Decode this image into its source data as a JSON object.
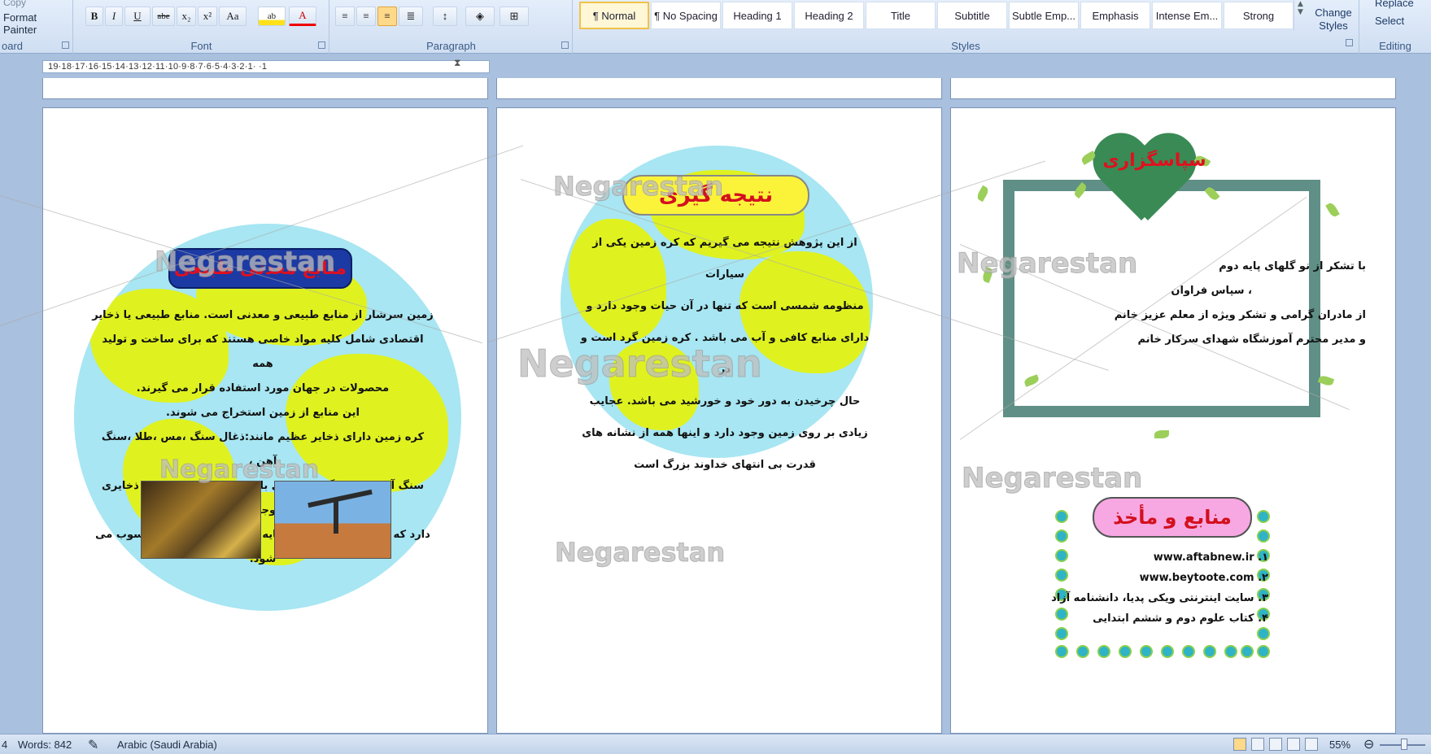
{
  "ribbon": {
    "clipboard": {
      "copy_label": "Copy",
      "format_painter_label": "Format Painter",
      "group_label": "oard"
    },
    "font": {
      "group_label": "Font",
      "buttons": [
        "B",
        "I",
        "U",
        "abe",
        "x₂",
        "x²",
        "Aa",
        "ab",
        "A"
      ]
    },
    "paragraph": {
      "group_label": "Paragraph"
    },
    "styles": {
      "group_label": "Styles",
      "items": [
        "¶ Normal",
        "¶ No Spacing",
        "Heading 1",
        "Heading 2",
        "Title",
        "Subtitle",
        "Subtle Emp...",
        "Emphasis",
        "Intense Em...",
        "Strong"
      ],
      "selected": "¶ Normal",
      "change_styles_label": "Change Styles"
    },
    "editing": {
      "group_label": "Editing",
      "replace_label": "Replace",
      "select_label": "Select"
    }
  },
  "ruler": {
    "ticks": "19·18·17·16·15·14·13·12·11·10·9·8·7·6·5·4·3·2·1·  ·1"
  },
  "watermark": "Negarestan",
  "page1": {
    "title": "منابع معدنی طبیعی",
    "lines": [
      "زمین سرشار از منابع طبیعی و معدنی است. منابع طبیعی یا ذخایر",
      "اقتصادی شامل کلیه مواد خاصی هستند که برای ساخت و تولید همه",
      "محصولات در جهان مورد استفاده قرار می گیرند.",
      "این منابع از زمین استخراج می شوند.",
      "کره زمین دارای ذخایر عظیم مانند:ذغال سنگ ،مس ،طلا ،سنگ آهن ،",
      "سنگ آهک ،نفت ،گاز و ... می باشد . هر نقطه از زمین ذخایری وجود",
      "دارد که ذخایر اقتصادی و سرمایه آن منطقه یا کشور محسوب می شود."
    ]
  },
  "page2": {
    "title": "نتیجه گیری",
    "lines": [
      "از این پژوهش نتیجه می گیریم که کره زمین یکی از سیارات",
      "منظومه شمسی است که تنها در آن حیات وجود دارد و",
      "دارای منابع کافی و آب می باشد . کره زمین گرد است و در",
      "حال چرخیدن به دور خود و خورشید می باشد. عجایب",
      "زیادی بر روی زمین وجود دارد و اینها همه از نشانه های",
      "قدرت بی انتهای خداوند بزرگ است"
    ]
  },
  "page3": {
    "thanks_title": "سپاسگزاری",
    "thanks_lines": [
      "با تشکر از نو گلهای پایه دوم",
      "، سپاس فراوان",
      "از مادران گرامی و تشکر ویژه از معلم عزیز خانم",
      "و مدیر محترم آموزشگاه شهدای          سرکار خانم"
    ],
    "refs_title": "منابع و مأخذ",
    "refs": [
      "www.aftabnew.ir .۱",
      "www.beytoote.com .۲",
      "۳. سایت اینترنتی ویکی پدیا، دانشنامه آزاد",
      "۴. کتاب علوم دوم و ششم ابتدایی"
    ]
  },
  "statusbar": {
    "page": "4",
    "words": "Words: 842",
    "language": "Arabic (Saudi Arabia)",
    "zoom": "55%"
  },
  "colors": {
    "globe": "#a7e6f2",
    "land": "#dff21f",
    "title_red": "#e0101e",
    "frame": "#5f8f86"
  }
}
